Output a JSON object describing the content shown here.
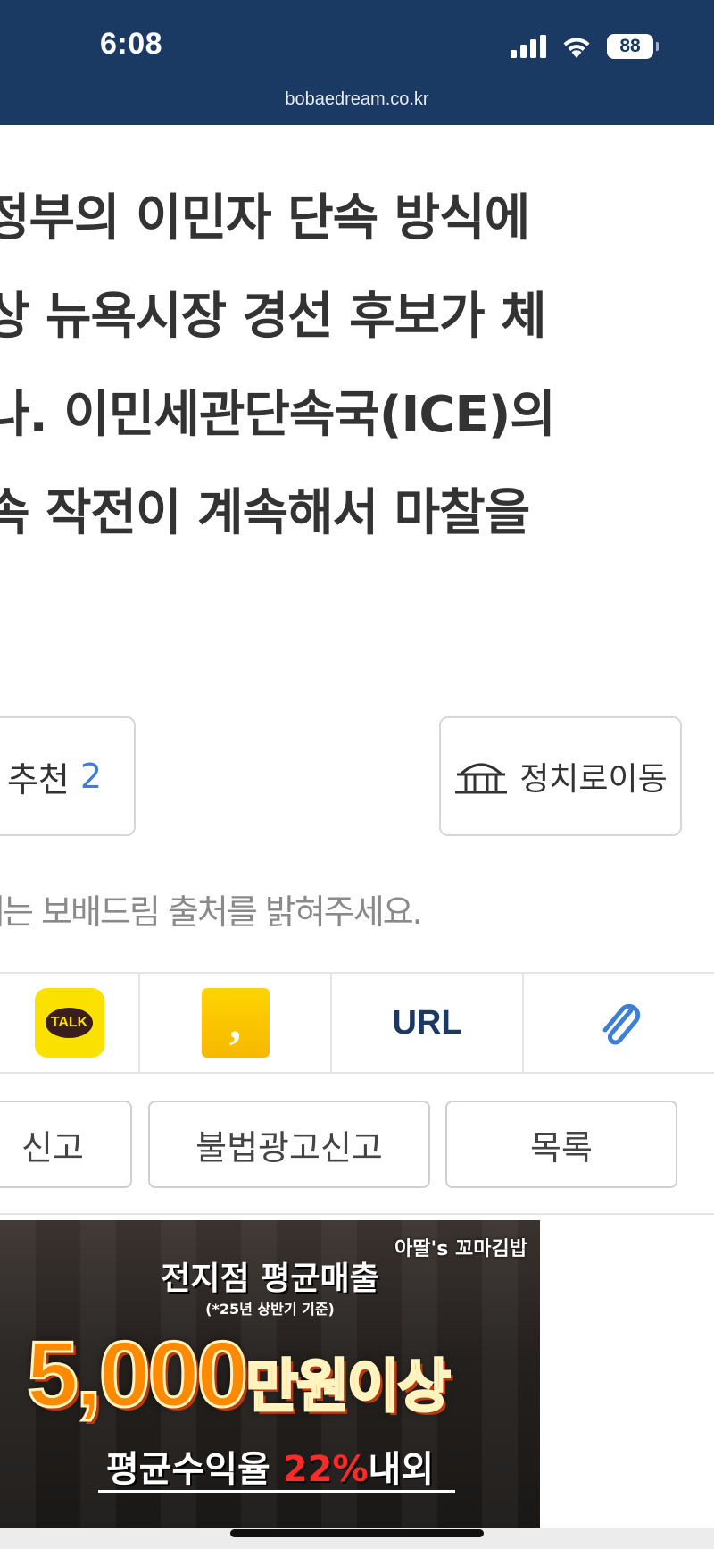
{
  "status_bar": {
    "time": "6:08",
    "battery": "88"
  },
  "browser": {
    "url": "bobaedream.co.kr"
  },
  "article": {
    "lines": [
      "정부의 이민자 단속 방식에",
      "상 뉴욕시장 경선 후보가 체",
      "나. 이민세관단속국(ICE)의",
      "속 작전이 계속해서 마찰을"
    ]
  },
  "actions": {
    "recommend_label": "추천",
    "recommend_count": "2",
    "politics_label": "정치로이동"
  },
  "notice": "때는 보배드림 출처를 밝혀주세요.",
  "share": {
    "kakaotalk_label": "TALK",
    "kakaostory_label": ",",
    "url_label": "URL"
  },
  "buttons": {
    "report": "신고",
    "illegal_ad_report": "불법광고신고",
    "list": "목록"
  },
  "ad": {
    "brand": "아딸's 꼬마김밥",
    "headline": "전지점 평균매출",
    "sub": "(*25년 상반기 기준)",
    "big_number": "5,000",
    "big_unit": "만원이상",
    "bottom_prefix": "평균수익율 ",
    "bottom_pct": "22%",
    "bottom_suffix": "내외"
  },
  "colors": {
    "header_bg": "#1b3a63",
    "accent_blue": "#3d7fd6",
    "kakao_yellow": "#fae100"
  }
}
